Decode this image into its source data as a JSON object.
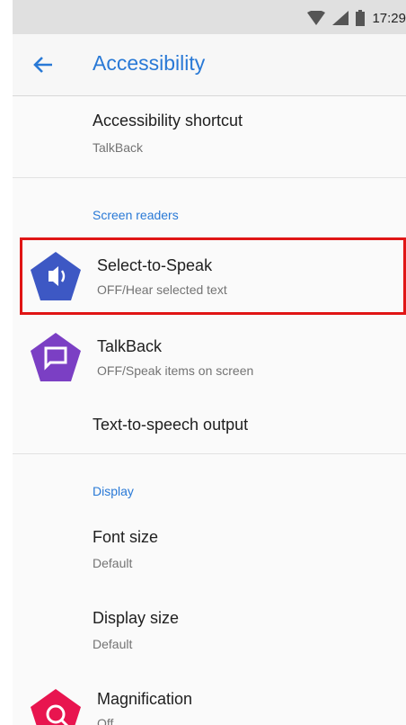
{
  "status_bar": {
    "time": "17:29",
    "icons": [
      "wifi-icon",
      "signal-icon",
      "battery-icon"
    ]
  },
  "app_bar": {
    "back_icon": "arrow-back-icon",
    "title": "Accessibility"
  },
  "items": {
    "accessibility_shortcut": {
      "title": "Accessibility shortcut",
      "summary": "TalkBack"
    },
    "select_to_speak": {
      "title": "Select-to-Speak",
      "summary": "OFF/Hear selected text",
      "icon": "select-to-speak-icon"
    },
    "talkback": {
      "title": "TalkBack",
      "summary": "OFF/Speak items on screen",
      "icon": "talkback-icon"
    },
    "tts_output": {
      "title": "Text-to-speech output"
    },
    "font_size": {
      "title": "Font size",
      "summary": "Default"
    },
    "display_size": {
      "title": "Display size",
      "summary": "Default"
    },
    "magnification": {
      "title": "Magnification",
      "summary": "Off",
      "icon": "magnification-icon"
    }
  },
  "sections": {
    "screen_readers": "Screen readers",
    "display": "Display"
  },
  "colors": {
    "accent": "#2979d6",
    "highlight": "#e01515",
    "select_to_speak_icon": "#3d58c4",
    "talkback_icon": "#7b3fc4",
    "magnification_icon": "#e8154f"
  }
}
